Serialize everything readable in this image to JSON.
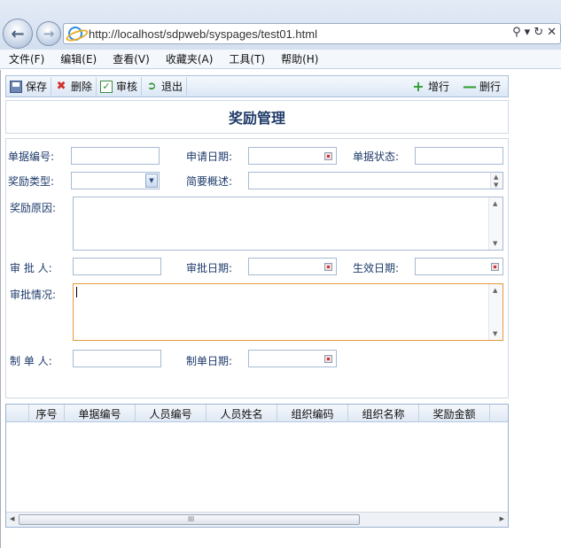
{
  "browser": {
    "url": "http://localhost/sdpweb/syspages/test01.html",
    "menu": [
      "文件(F)",
      "编辑(E)",
      "查看(V)",
      "收藏夹(A)",
      "工具(T)",
      "帮助(H)"
    ]
  },
  "toolbar": {
    "save": "保存",
    "delete": "删除",
    "approve": "审核",
    "exit": "退出",
    "add_row": "增行",
    "delete_row": "删行"
  },
  "page": {
    "title": "奖励管理"
  },
  "form": {
    "doc_no_label": "单据编号:",
    "apply_date_label": "申请日期:",
    "doc_status_label": "单据状态:",
    "reward_type_label": "奖励类型:",
    "summary_label": "简要概述:",
    "reward_reason_label": "奖励原因:",
    "approver_label": "审 批 人:",
    "approve_date_label": "审批日期:",
    "effective_date_label": "生效日期:",
    "approval_status_label": "审批情况:",
    "creator_label": "制 单 人:",
    "create_date_label": "制单日期:"
  },
  "grid": {
    "columns": [
      "序号",
      "单据编号",
      "人员编号",
      "人员姓名",
      "组织编码",
      "组织名称",
      "奖励金额"
    ]
  },
  "colors": {
    "label_text": "#1d3a6a",
    "title_text": "#1f3b68",
    "focus_border": "#e49a3d",
    "panel_border": "#a9bfdc"
  }
}
